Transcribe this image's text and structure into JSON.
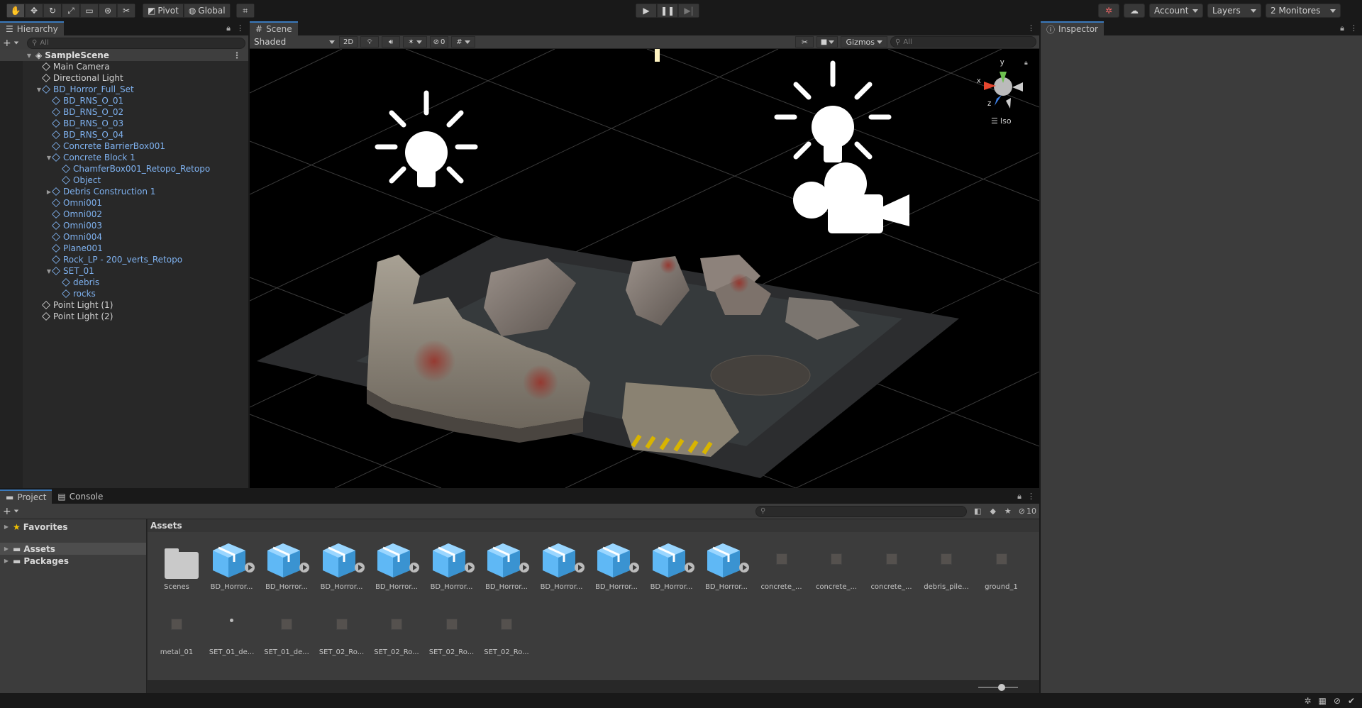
{
  "toolbar": {
    "tools": [
      "hand-tool",
      "move-tool",
      "rotate-tool",
      "scale-tool",
      "rect-tool",
      "transform-tool",
      "custom-tool"
    ],
    "pivot_label": "Pivot",
    "global_label": "Global",
    "play_icons": [
      "play",
      "pause",
      "step"
    ],
    "account_label": "Account",
    "layers_label": "Layers",
    "layout_label": "2 Monitores"
  },
  "hierarchy": {
    "tab_label": "Hierarchy",
    "search_placeholder": "All",
    "scene_name": "SampleScene",
    "items": [
      {
        "label": "Main Camera",
        "depth": 1,
        "color": "white",
        "arrow": ""
      },
      {
        "label": "Directional Light",
        "depth": 1,
        "color": "white",
        "arrow": ""
      },
      {
        "label": "BD_Horror_Full_Set",
        "depth": 1,
        "color": "blue",
        "arrow": "open"
      },
      {
        "label": "BD_RNS_O_01",
        "depth": 2,
        "color": "blue",
        "arrow": ""
      },
      {
        "label": "BD_RNS_O_02",
        "depth": 2,
        "color": "blue",
        "arrow": ""
      },
      {
        "label": "BD_RNS_O_03",
        "depth": 2,
        "color": "blue",
        "arrow": ""
      },
      {
        "label": "BD_RNS_O_04",
        "depth": 2,
        "color": "blue",
        "arrow": ""
      },
      {
        "label": "Concrete BarrierBox001",
        "depth": 2,
        "color": "blue",
        "arrow": ""
      },
      {
        "label": "Concrete Block 1",
        "depth": 2,
        "color": "blue",
        "arrow": "open"
      },
      {
        "label": "ChamferBox001_Retopo_Retopo",
        "depth": 3,
        "color": "blue",
        "arrow": ""
      },
      {
        "label": "Object",
        "depth": 3,
        "color": "blue",
        "arrow": ""
      },
      {
        "label": "Debris Construction 1",
        "depth": 2,
        "color": "blue",
        "arrow": "closed"
      },
      {
        "label": "Omni001",
        "depth": 2,
        "color": "blue",
        "arrow": ""
      },
      {
        "label": "Omni002",
        "depth": 2,
        "color": "blue",
        "arrow": ""
      },
      {
        "label": "Omni003",
        "depth": 2,
        "color": "blue",
        "arrow": ""
      },
      {
        "label": "Omni004",
        "depth": 2,
        "color": "blue",
        "arrow": ""
      },
      {
        "label": "Plane001",
        "depth": 2,
        "color": "blue",
        "arrow": ""
      },
      {
        "label": "Rock_LP - 200_verts_Retopo",
        "depth": 2,
        "color": "blue",
        "arrow": ""
      },
      {
        "label": "SET_01",
        "depth": 2,
        "color": "blue",
        "arrow": "open"
      },
      {
        "label": "debris",
        "depth": 3,
        "color": "blue",
        "arrow": ""
      },
      {
        "label": "rocks",
        "depth": 3,
        "color": "blue",
        "arrow": ""
      },
      {
        "label": "Point Light (1)",
        "depth": 1,
        "color": "white",
        "arrow": ""
      },
      {
        "label": "Point Light (2)",
        "depth": 1,
        "color": "white",
        "arrow": ""
      }
    ]
  },
  "scene": {
    "tab_label": "Scene",
    "shading_mode": "Shaded",
    "mode_2d": "2D",
    "hidden_count": "0",
    "gizmos_label": "Gizmos",
    "search_placeholder": "All",
    "projection_label": "Iso",
    "axis_labels": {
      "x": "x",
      "y": "y",
      "z": "z"
    }
  },
  "inspector": {
    "tab_label": "Inspector"
  },
  "project": {
    "tab_project": "Project",
    "tab_console": "Console",
    "hidden_count": "10",
    "tree": [
      {
        "label": "Favorites",
        "icon": "star-icon",
        "selected": false
      },
      {
        "label": "Assets",
        "icon": "folder-icon",
        "selected": true
      },
      {
        "label": "Packages",
        "icon": "folder-icon",
        "selected": false
      }
    ],
    "breadcrumb": "Assets",
    "assets_row1": [
      {
        "label": "Scenes",
        "kind": "folder"
      },
      {
        "label": "BD_Horror...",
        "kind": "prefab"
      },
      {
        "label": "BD_Horror...",
        "kind": "prefab"
      },
      {
        "label": "BD_Horror...",
        "kind": "prefab"
      },
      {
        "label": "BD_Horror...",
        "kind": "prefab"
      },
      {
        "label": "BD_Horror...",
        "kind": "prefab"
      },
      {
        "label": "BD_Horror...",
        "kind": "prefab"
      },
      {
        "label": "BD_Horror...",
        "kind": "prefab"
      },
      {
        "label": "BD_Horror...",
        "kind": "prefab"
      },
      {
        "label": "BD_Horror...",
        "kind": "prefab"
      },
      {
        "label": "BD_Horror...",
        "kind": "prefab"
      },
      {
        "label": "concrete_...",
        "kind": "material"
      },
      {
        "label": "concrete_...",
        "kind": "material"
      },
      {
        "label": "concrete_...",
        "kind": "material"
      },
      {
        "label": "debris_pile...",
        "kind": "material"
      },
      {
        "label": "ground_1",
        "kind": "material"
      }
    ],
    "assets_row2": [
      {
        "label": "metal_01",
        "kind": "material"
      },
      {
        "label": "SET_01_de...",
        "kind": "mesh"
      },
      {
        "label": "SET_01_de...",
        "kind": "material"
      },
      {
        "label": "SET_02_Ro...",
        "kind": "material"
      },
      {
        "label": "SET_02_Ro...",
        "kind": "material"
      },
      {
        "label": "SET_02_Ro...",
        "kind": "material"
      },
      {
        "label": "SET_02_Ro...",
        "kind": "material"
      }
    ]
  },
  "colors": {
    "accent": "#3a79bb",
    "prefab": "#5fb8f5",
    "hierarchy_blue": "#7fb2f0"
  }
}
